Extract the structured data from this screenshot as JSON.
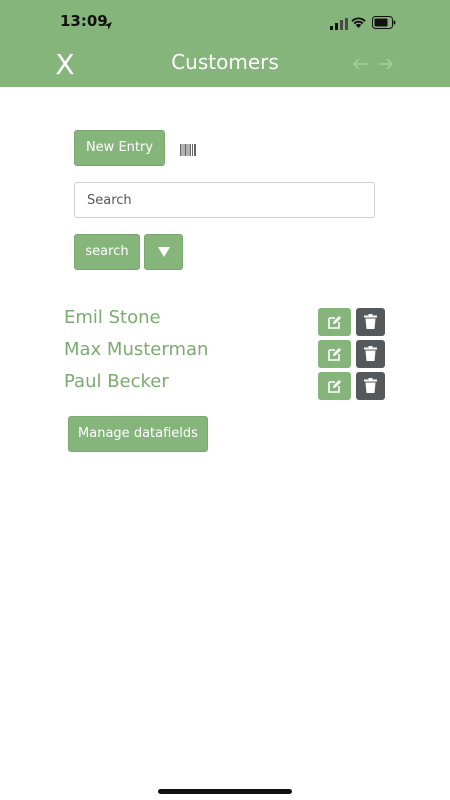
{
  "status_bar": {
    "time": "13:09",
    "icons": [
      "location-arrow-icon",
      "cell-signal-icon",
      "wifi-icon",
      "battery-icon"
    ]
  },
  "header": {
    "close_label": "X",
    "title": "Customers",
    "back_icon": "arrow-left-icon",
    "forward_icon": "arrow-right-icon"
  },
  "toolbar": {
    "new_entry_label": "New Entry",
    "barcode_icon": "barcode-icon"
  },
  "search": {
    "placeholder": "Search",
    "value": "",
    "button_label": "search",
    "dropdown_icon": "caret-down-icon"
  },
  "customers": [
    {
      "name": "Emil Stone"
    },
    {
      "name": "Max Musterman"
    },
    {
      "name": "Paul Becker"
    }
  ],
  "row_actions": {
    "edit_icon": "edit-icon",
    "delete_icon": "trash-icon"
  },
  "footer": {
    "manage_label": "Manage datafields"
  },
  "colors": {
    "accent": "#86b57c",
    "name_text": "#7bab70",
    "delete_button": "#55595c"
  }
}
